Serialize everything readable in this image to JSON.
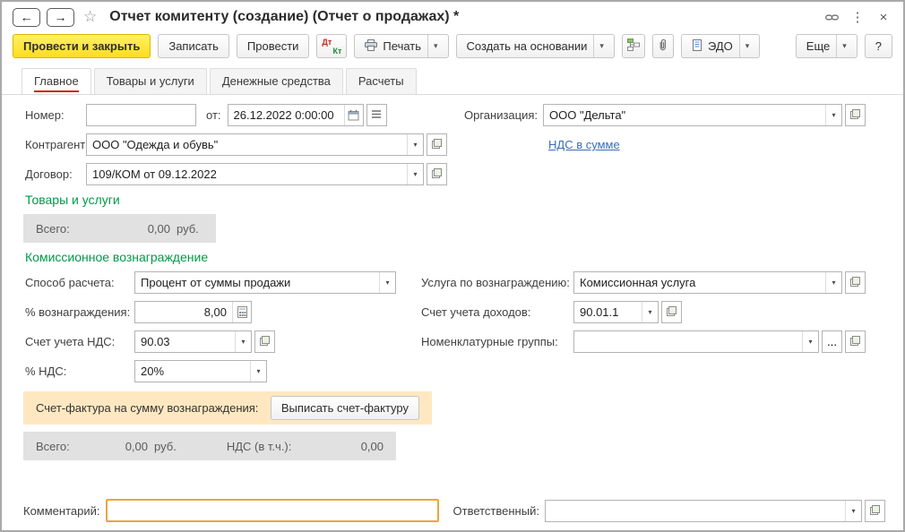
{
  "window": {
    "title": "Отчет комитенту (создание) (Отчет о продажах) *"
  },
  "toolbar": {
    "post_and_close": "Провести и закрыть",
    "save": "Записать",
    "post": "Провести",
    "dt": "Дт",
    "kt": "Кт",
    "print": "Печать",
    "create_based_on": "Создать на основании",
    "edo": "ЭДО",
    "more": "Еще",
    "help": "?"
  },
  "tabs": [
    {
      "label": "Главное"
    },
    {
      "label": "Товары и услуги"
    },
    {
      "label": "Денежные средства"
    },
    {
      "label": "Расчеты"
    }
  ],
  "header_fields": {
    "number_label": "Номер:",
    "number_value": "",
    "date_label": "от:",
    "date_value": "26.12.2022 0:00:00",
    "organization_label": "Организация:",
    "organization_value": "ООО \"Дельта\"",
    "counterparty_label": "Контрагент:",
    "counterparty_value": "ООО \"Одежда и обувь\"",
    "vat_in_sum_link": "НДС в сумме",
    "contract_label": "Договор:",
    "contract_value": "109/КОМ от 09.12.2022"
  },
  "goods": {
    "section_title": "Товары и услуги",
    "total_label": "Всего:",
    "total_value": "0,00",
    "currency": "руб."
  },
  "commission": {
    "section_title": "Комиссионное вознаграждение",
    "calc_method_label": "Способ расчета:",
    "calc_method_value": "Процент от суммы продажи",
    "service_label": "Услуга по вознаграждению:",
    "service_value": "Комиссионная услуга",
    "percent_label": "% вознаграждения:",
    "percent_value": "8,00",
    "income_account_label": "Счет учета доходов:",
    "income_account_value": "90.01.1",
    "vat_account_label": "Счет учета НДС:",
    "vat_account_value": "90.03",
    "nomenclature_label": "Номенклатурные группы:",
    "nomenclature_value": "",
    "ellipsis": "...",
    "vat_percent_label": "% НДС:",
    "vat_percent_value": "20%",
    "invoice_label": "Счет-фактура на сумму вознаграждения:",
    "invoice_button": "Выписать счет-фактуру",
    "total_label": "Всего:",
    "total_value": "0,00",
    "currency": "руб.",
    "vat_total_label": "НДС (в т.ч.):",
    "vat_total_value": "0,00"
  },
  "footer": {
    "comment_label": "Комментарий:",
    "comment_value": "",
    "responsible_label": "Ответственный:",
    "responsible_value": ""
  },
  "colors": {
    "primary_button": "#FFE646",
    "section_title_green": "#009A49",
    "active_tab_underline": "#CE2A1E",
    "link_blue": "#3A6DB5",
    "highlight_bar": "#FFE8C1",
    "total_bar": "#E1E1E1",
    "comment_border": "#EBA53C"
  }
}
